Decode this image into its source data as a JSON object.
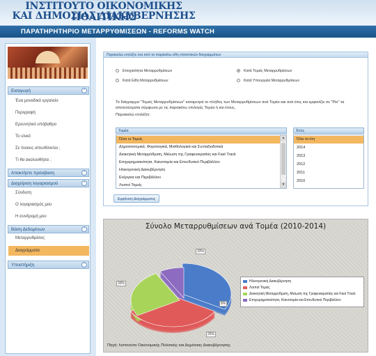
{
  "header": {
    "title_line1": "ΙΝΣΤΙΤΟΥΤΟ ΟΙΚΟΝΟΜΙΚΗΣ ΠΟΛΙΤΙΚΗΣ",
    "title_line2": "ΚΑΙ ΔΗΜΟΣΙΑΣ ΔΙΑΚΥΒΕΡΝΗΣΗΣ",
    "subtitle": "ΠΑΡΑΤΗΡΗΤΗΡΙΟ ΜΕΤΑΡΡΥΘΜΙΣΕΩΝ - REFORMS WATCH"
  },
  "sidebar": {
    "sections": [
      {
        "label": "Εισαγωγή",
        "items": [
          "Ένα μοναδικό εργαλείο",
          "Περιγραφή",
          "Ερευνητικό υπόβαθρο",
          "Το υλικό",
          "Σε ποιους απευθύνεται ;",
          "Τι θα ακολουθήσει ;"
        ]
      },
      {
        "label": "Αποκτήστε πρόσβαση",
        "items": []
      },
      {
        "label": "Διαχείριση λογαριασμού",
        "items": [
          "Σύνδεση",
          "Ο λογαριασμός μου",
          "Η συνδρομή μου"
        ]
      },
      {
        "label": "Βάση Δεδομένων",
        "items": [
          "Μεταρρυθμίσεις",
          "Διαγράμματα"
        ]
      },
      {
        "label": "Υποστήριξη",
        "items": []
      }
    ],
    "collapse_glyph": "⌃"
  },
  "panel": {
    "heading": "Παρακαλώ επιλέξτε ένα από τα παρακάτω είδη στατιστικών διαγραμμάτων",
    "radios": [
      {
        "label": "Εποχικότητα Μεταρρυθμίσεων",
        "checked": false
      },
      {
        "label": "Κατά Τομείς Μεταρρυθμίσεων",
        "checked": true
      },
      {
        "label": "Κατά Είδη Μεταρρυθμίσεων",
        "checked": false
      },
      {
        "label": "Κατά Υπουργεία Μεταρρυθμίσεων",
        "checked": false
      }
    ],
    "description": "Το διάγραμμα \"Τομείς Μεταρρυθμίσεων\" καταμετρά το πλήθος των Μεταρρυθμίσεων ανά Τομέα και ανά έτος και εμφανίζει σε \"Pie\" τα αποτελέσματα σύμφωνα με τις παρακάτω επιλογές Τομέα ή και έτους.",
    "prompt": "Παρακαλώ επιλέξτε:",
    "sector_header": "Τομέα",
    "sectors": [
      "Όλοι οι Τομείς",
      "Δημοσιονομικά, Φορολογικά, Μισθολογικά και Συνταξιοδοτικά",
      "Διοικητική Μεταρρύθμιση, Μείωση της Γραφειοκρατίας και Fast Track",
      "Επιχειρηματικότητα, Καινοτομία και Επενδυτικό Περιβάλλον",
      "Ηλεκτρονική Διακυβέρνηση",
      "Ενέργεια και Περιβάλλον",
      "Λοιποί Τομείς"
    ],
    "year_header": "Έτος",
    "years": [
      "Όλα τα έτη",
      "2014",
      "2013",
      "2012",
      "2011",
      "2010"
    ],
    "show_button": "Εμφάνιση Διαγράμματος"
  },
  "chart_data": {
    "type": "pie",
    "title": "Σύνολο Μεταρρυθμίσεων ανά Τομέα (2010-2014)",
    "series": [
      {
        "name": "Ηλεκτρονική Διακυβέρνηση",
        "value": 33,
        "color": "#4a7cc9"
      },
      {
        "name": "Λοιποί Τομείς",
        "value": 33,
        "color": "#e05a5a"
      },
      {
        "name": "Διοικητική Μεταρρύθμιση, Μείωση της Γραφειοκρατίας και Fast Track",
        "value": 25,
        "color": "#a9d45a"
      },
      {
        "name": "Επιχειρηματικότητα, Καινοτομία και Επενδυτικό Περιβάλλον",
        "value": 8,
        "color": "#8c6bc1"
      }
    ],
    "labels": [
      "33%",
      "33%",
      "25%",
      "8%"
    ],
    "legend_position": "right",
    "source": "Πηγή: Ινστιτούτο Οικονομικής Πολιτικής και Δημόσιας Διακυβέρνησης"
  }
}
